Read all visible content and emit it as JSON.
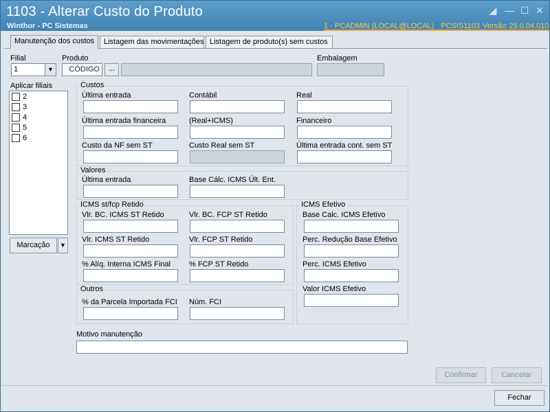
{
  "window": {
    "title": "1103 - Alterar Custo do Produto",
    "subtitle": "Winthor - PC Sistemas",
    "status": {
      "user": "1 - PCADMIN (LOCAL@LOCAL)",
      "program": "PCSIS1103",
      "version_label": "Versão",
      "version": "29.0.04.010"
    }
  },
  "tabs": [
    {
      "label": "Manutenção dos custos",
      "active": true
    },
    {
      "label": "Listagem das movimentações",
      "active": false
    },
    {
      "label": "Listagem de produto(s)  sem custos",
      "active": false
    }
  ],
  "filial": {
    "label": "Filial",
    "value": "1"
  },
  "produto": {
    "label": "Produto",
    "code_placeholder": "CÓDIGO",
    "browse_label": "..."
  },
  "embalagem": {
    "label": "Embalagem"
  },
  "aplicar_filiais": {
    "label": "Aplicar filiais",
    "items": [
      "2",
      "3",
      "4",
      "5",
      "6"
    ]
  },
  "marcacao_label": "Marcação",
  "custos": {
    "title": "Custos",
    "ultima_entrada": "Última entrada",
    "contabil": "Contábil",
    "real": "Real",
    "ultima_entrada_financeira": "Última entrada financeira",
    "real_icms": "(Real+ICMS)",
    "financeiro": "Financeiro",
    "custo_nf_sem_st": "Custo da NF sem ST",
    "custo_real_sem_st": "Custo Real sem ST",
    "ultima_entrada_cont_sem_st": "Última entrada cont. sem ST"
  },
  "valores": {
    "title": "Valores",
    "ultima_entrada": "Última entrada",
    "base_calc_icms": "Base Cálc. ICMS Últ. Ent."
  },
  "icms_st": {
    "title": "ICMS st/fcp Retido",
    "vlr_bc_icms_st": "Vlr. BC. ICMS ST Retido",
    "vlr_bc_fcp_st": "Vlr. BC. FCP ST Retido",
    "vlr_icms_st": "Vlr. ICMS ST Retido",
    "vlr_fcp_st": "Vlr. FCP ST Retido",
    "aliq_interna": "% Alíq. Interna ICMS Final",
    "fcp_st_retido": "% FCP ST Retido"
  },
  "icms_efetivo": {
    "title": "ICMS Efetivo",
    "base_calc": "Base Calc. ICMS Efetivo",
    "perc_reducao": "Perc. Redução Base Efetivo",
    "perc_icms": "Perc. ICMS Efetivo",
    "valor_icms": "Valor ICMS Efetivo"
  },
  "outros": {
    "title": "Outros",
    "parcela_importada": "% da Parcela Importada FCI",
    "num_fci": "Núm. FCI"
  },
  "motivo": {
    "label": "Motivo manutenção"
  },
  "buttons": {
    "confirmar": "Confirmar",
    "cancelar": "Cancelar",
    "fechar": "Fechar"
  }
}
